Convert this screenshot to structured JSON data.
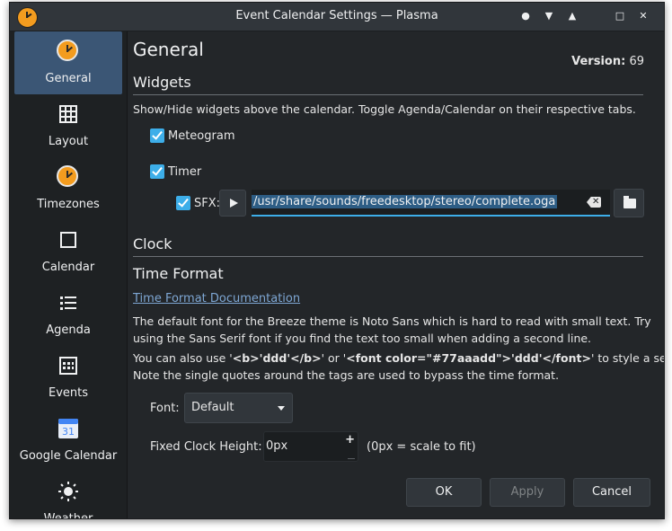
{
  "window": {
    "title": "Event Calendar Settings — Plasma",
    "controls": [
      "●",
      "▼",
      "▲",
      "□",
      "✕"
    ]
  },
  "sidebar": {
    "items": [
      {
        "label": "General",
        "icon": "clock-icon",
        "active": true
      },
      {
        "label": "Layout",
        "icon": "grid-icon"
      },
      {
        "label": "Timezones",
        "icon": "clock-icon"
      },
      {
        "label": "Calendar",
        "icon": "square-icon"
      },
      {
        "label": "Agenda",
        "icon": "list-icon"
      },
      {
        "label": "Events",
        "icon": "calendar-grid-icon"
      },
      {
        "label": "Google Calendar",
        "icon": "google-calendar-icon",
        "icon_text": "31"
      },
      {
        "label": "Weather",
        "icon": "sun-icon"
      }
    ]
  },
  "page": {
    "title": "General",
    "version_label": "Version:",
    "version_value": "69"
  },
  "widgets": {
    "heading": "Widgets",
    "description": "Show/Hide widgets above the calendar. Toggle Agenda/Calendar on their respective tabs.",
    "meteogram_label": "Meteogram",
    "meteogram_checked": true,
    "timer_label": "Timer",
    "timer_checked": true,
    "sfx_label": "SFX:",
    "sfx_checked": true,
    "sfx_path": "/usr/share/sounds/freedesktop/stereo/complete.oga"
  },
  "clock": {
    "heading": "Clock",
    "time_format_heading": "Time Format",
    "doc_link": "Time Format Documentation",
    "font_note_line1": "The default font for the Breeze theme is Noto Sans which is hard to read with small text. Try",
    "font_note_line2": "using the Sans Serif font if you find the text too small when adding a second line.",
    "style_note_pre": "You can also use '",
    "style_note_code1": "<b>'ddd'</b>",
    "style_note_mid": "' or '",
    "style_note_code2": "<font color=\"#77aaadd\">'ddd'</font>",
    "style_note_post": "' to style a section.",
    "quotes_note": "Note the single quotes around the tags are used to bypass the time format.",
    "font_label": "Font:",
    "font_value": "Default",
    "height_label": "Fixed Clock Height:",
    "height_value": "0px",
    "height_hint": "(0px = scale to fit)"
  },
  "buttons": {
    "ok": "OK",
    "apply": "Apply",
    "cancel": "Cancel"
  },
  "colors": {
    "accent": "#3daee9",
    "sidebar_active": "#3b5675",
    "link": "#7ea7d4",
    "clock_orange": "#f39c1f"
  }
}
